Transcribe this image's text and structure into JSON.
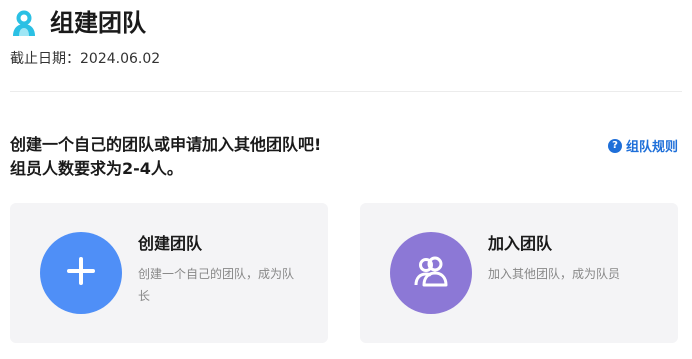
{
  "header": {
    "title": "组建团队",
    "logo_icon": "team-logo-icon",
    "deadline_label": "截止日期：",
    "deadline_value": "2024.06.02"
  },
  "intro": {
    "line1": "创建一个自己的团队或申请加入其他团队吧!",
    "line2": "组员人数要求为2-4人。"
  },
  "rules_link": {
    "label": "组队规则",
    "icon": "help-circle-icon"
  },
  "cards": [
    {
      "title": "创建团队",
      "description": "创建一个自己的团队，成为队长",
      "icon": "plus-icon",
      "color": "#4f8ff7"
    },
    {
      "title": "加入团队",
      "description": "加入其他团队，成为队员",
      "icon": "users-icon",
      "color": "#8c78d6"
    }
  ],
  "colors": {
    "accent": "#1e6fd9",
    "logo": "#2bc0e4",
    "card_bg": "#f4f4f6"
  }
}
